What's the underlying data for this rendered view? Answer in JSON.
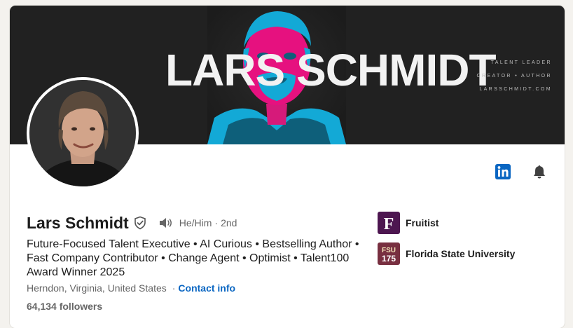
{
  "banner": {
    "title": "LARS SCHMIDT",
    "tagline": [
      "TALENT LEADER",
      "CREATOR • AUTHOR",
      "LARSSCHMIDT.COM"
    ]
  },
  "profile": {
    "name": "Lars Schmidt",
    "pronouns": "He/Him",
    "degree_sep": "·",
    "degree": "2nd",
    "headline": "Future-Focused Talent Executive • AI Curious • Bestselling Author • Fast Company Contributor • Change Agent • Optimist • Talent100 Award Winner 2025",
    "location": "Herndon, Virginia, United States",
    "location_sep": "·",
    "contact_link": "Contact info",
    "followers": "64,134 followers"
  },
  "orgs": [
    {
      "name": "Fruitist",
      "logo_text": "F",
      "logo_color": "#4d1650"
    },
    {
      "name": "Florida State University",
      "logo_text_top": "FSU",
      "logo_text_bottom": "175",
      "logo_color": "#782f40"
    }
  ],
  "icons": {
    "linkedin": "linkedin-icon",
    "bell": "bell-icon",
    "verified": "verified-shield-icon",
    "speaker": "speaker-icon"
  },
  "colors": {
    "accent": "#0a66c2",
    "banner_bg": "#212121",
    "portrait_magenta": "#e6117f",
    "portrait_cyan": "#13a9d6"
  }
}
